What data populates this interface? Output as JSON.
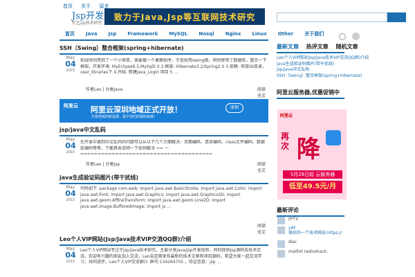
{
  "header": {
    "toplinks": [
      "首页",
      "关于",
      "留言"
    ],
    "logo": "Jsp开发网",
    "logo_sub": "专注jsp技术研究",
    "banner": "致力于Java,Jsp等互联网技术研究",
    "search_placeholder": ""
  },
  "nav": [
    "首页",
    "Java",
    "Jsp",
    "Framework",
    "MySQL",
    "Nosql",
    "Nginx",
    "Linux",
    "Other",
    "关于我们"
  ],
  "posts": [
    {
      "title": "SSH（Swing）整合框架(spring+hibernate)",
      "month": "May",
      "day": "04",
      "year": "2015",
      "body": "前段时间用到了一个小项目，需要做一个桌面程序，于是就用swing做，同时使用了数据库，整合一下框架。开发环境: MyEclipse6.5,MySql5.0 2.框架: Hibernate3.2/Spring2.0 3.依赖: 项目lib目录，user_libraries下 4.开始: 新建Java_Login 项目 5 ...",
      "meta_author": "作者Leo | 分类Java",
      "more": "阅读全文"
    },
    {
      "title": "jsp/java中文乱码",
      "month": "May",
      "day": "04",
      "year": "2015",
      "body": "在开发中遇到中文乱码的问题可以从以下几个方面解决：页面编码、请求编码、class文件编码、数据库编码等等，下面具体说明一下如何解决 == 一 ====================================== ———————————————& ...",
      "meta_author": "作者Leo | 分类Jsp",
      "more": "阅读全文"
    },
    {
      "title": "java生成验证码图片(带干扰线)",
      "month": "May",
      "day": "04",
      "year": "2015",
      "body": "代码如下: package com.web; import java.awt.BasicStroke; import java.awt.Color; import java.awt.Font; import java.awt.Graphics; import java.awt.Graphics2D; import java.awt.geom.AffineTransform; import java.awt.geom.Line2D; import java.awt.image.BufferedImage; import ja ...",
      "more": "阅读全文"
    },
    {
      "title": "Leo个人VIP网站(Jsp/Java技术VIP交流QQ群)介绍",
      "month": "May",
      "day": "04",
      "year": "2015",
      "body": "Leo个人VIP网站专注于jsp/java技术研究，主要分享java/jsp开发经验，同时提供jsp源码及技术交流。欢迎有兴趣的朋友加入交流，Leo会定期发布最新的技术文章和项目源码，希望大家一起交流学习，共同进步。Leo个人VIP交流群(): 群号:134264755 ，验证信息：jsp ..."
    }
  ],
  "ad": {
    "brand": "阿里云",
    "title": "阿里云深圳地域正式开放！",
    "sub": "华南地域的新选择，属于你们的福利来袭！",
    "pill": "深圳"
  },
  "sidebar": {
    "tabs": [
      "最新文章",
      "热评文章",
      "随机文章"
    ],
    "articles": [
      "Leo个人VIP网站(Jsp/Java技术VIP交流QQ群)介绍",
      "java生成验证码图片(带干扰线)",
      "jsp/java中文乱码",
      "SSH（Swing）整合框架(spring+hibernate)"
    ],
    "promo_title": "阿里云服务器,优惠促销中",
    "promo": {
      "brand": "阿里云",
      "big": "降",
      "side": "再次",
      "line1": "5月28日起 云服务器",
      "line2": "低至49.5元/月"
    },
    "comments_title": "最新评论",
    "comments": [
      {
        "text": "jerry:"
      },
      {
        "text": "ydf:\n很好的一个技术网站 https://"
      },
      {
        "text": "dsa:"
      },
      {
        "text": "maillot radioshack:"
      }
    ]
  }
}
